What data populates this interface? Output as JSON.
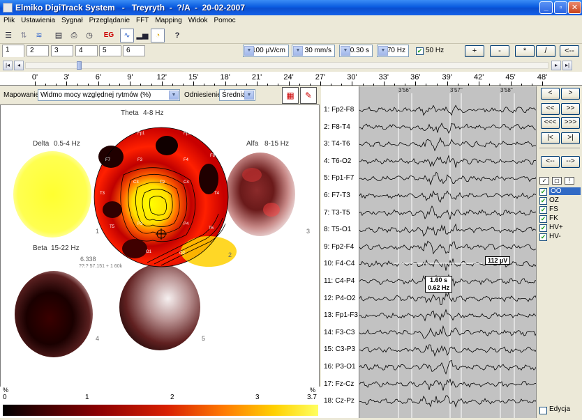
{
  "window": {
    "title": "Elmiko DigiTrack System   -   Treyryth  -  ?/A  -  20-02-2007"
  },
  "menu": [
    "Plik",
    "Ustawienia",
    "Sygnał",
    "Przeglądanie",
    "FFT",
    "Mapping",
    "Widok",
    "Pomoc"
  ],
  "toolbar": {
    "eg_label": "EG",
    "help_label": "?"
  },
  "pages": [
    "1",
    "2",
    "3",
    "4",
    "5",
    "6"
  ],
  "settings": {
    "sensitivity": "100 µV/cm",
    "speed": "30 mm/s",
    "time_const": "0.30 s",
    "filter": "70 Hz",
    "notch_label": "50 Hz",
    "buttons": [
      "+",
      "-",
      "*",
      "/",
      "<--"
    ]
  },
  "ruler": [
    "0'",
    "3'",
    "6'",
    "9'",
    "12'",
    "15'",
    "18'",
    "21'",
    "24'",
    "27'",
    "30'",
    "33'",
    "36'",
    "39'",
    "42'",
    "45'",
    "48'"
  ],
  "mapping": {
    "map_label": "Mapowanie:",
    "map_value": "Widmo mocy względnej rytmów (%)",
    "ref_label": "Odniesienie:",
    "ref_value": "Średnia",
    "maps": [
      {
        "name": "Delta",
        "range": "0.5-4 Hz",
        "num": "1"
      },
      {
        "name": "Theta",
        "range": "4-8 Hz",
        "num": "2"
      },
      {
        "name": "Alfa",
        "range": "8-15 Hz",
        "num": "3"
      },
      {
        "name": "Beta",
        "range": "15-22 Hz",
        "num": "4"
      },
      {
        "name": "",
        "range": "",
        "num": "5"
      }
    ],
    "theta_peak": "6.338",
    "theta_note": "??:? 57.151 + 1 60k",
    "electrodes": [
      "Fp1",
      "Fp2",
      "F7",
      "F3",
      "F4",
      "F8",
      "T3",
      "C3",
      "Cz",
      "C4",
      "T4",
      "T5",
      "P3",
      "P4",
      "T6",
      "O1",
      "O2"
    ],
    "scale": {
      "unit_left": "%",
      "unit_right": "%",
      "ticks": [
        "0",
        "1",
        "2",
        "3",
        "3.7"
      ]
    }
  },
  "eeg": {
    "channels": [
      "1: Fp2-F8",
      "2: F8-T4",
      "3: T4-T6",
      "4: T6-O2",
      "5: Fp1-F7",
      "6: F7-T3",
      "7: T3-T5",
      "8: T5-O1",
      "9: Fp2-F4",
      "10: F4-C4",
      "11: C4-P4",
      "12: P4-O2",
      "13: Fp1-F3",
      "14: F3-C3",
      "15: C3-P3",
      "16: P3-O1",
      "17: Fz-Cz",
      "18: Cz-Pz"
    ],
    "times": [
      "3'56\"",
      "3'57\"",
      "3'58\""
    ],
    "amp_label": "112 µV",
    "measure_time": "1.60 s",
    "measure_freq": "0.62 Hz"
  },
  "right": {
    "nav_buttons": [
      "<",
      ">",
      "<<",
      ">>",
      "<<<",
      ">>>",
      "|<",
      ">|",
      "<--",
      "-->"
    ],
    "list": [
      "OO",
      "OZ",
      "FS",
      "FK",
      "HV+",
      "HV-"
    ],
    "edit_label": "Edycja"
  }
}
